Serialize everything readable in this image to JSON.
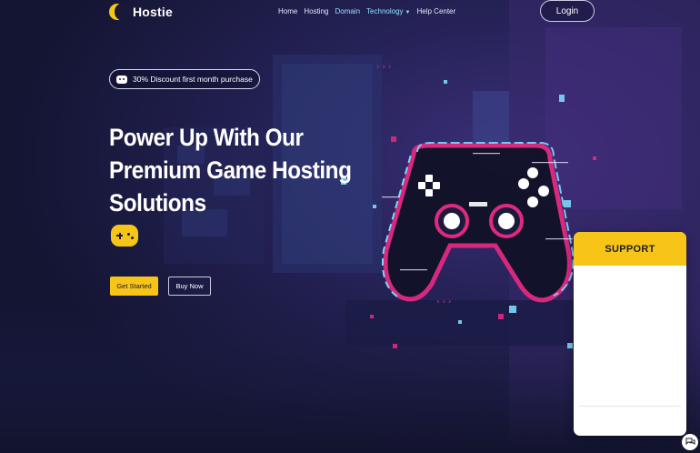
{
  "brand": {
    "name": "Hostie"
  },
  "nav": {
    "items": [
      {
        "label": "Home"
      },
      {
        "label": "Hosting"
      },
      {
        "label": "Domain"
      },
      {
        "label": "Technology"
      },
      {
        "label": "Help Center"
      }
    ]
  },
  "header": {
    "login_label": "Login"
  },
  "hero": {
    "badge_text": "30% Discount first month purchase",
    "title_lines": [
      "Power Up With Our",
      "Premium Game Hosting",
      "Solutions"
    ],
    "primary_button": "Get Started",
    "secondary_button": "Buy Now"
  },
  "support_widget": {
    "title": "SUPPORT"
  },
  "colors": {
    "accent": "#f7c518",
    "background": "#17183a",
    "neon_pink": "#e0297f",
    "neon_cyan": "#7ed8f8"
  },
  "icons": {
    "logo": "logo-mark-icon",
    "badge": "gamepad-icon",
    "hero": "gamepad-icon",
    "nav_caret": "chevron-down-icon",
    "chat": "chat-bubble-icon"
  }
}
